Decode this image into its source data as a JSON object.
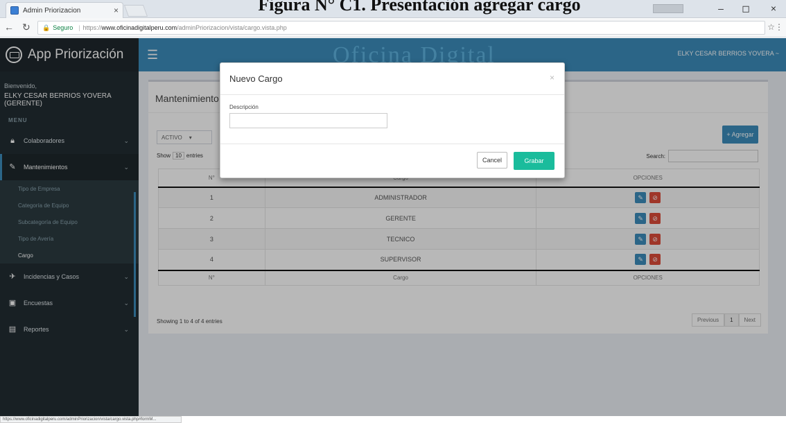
{
  "caption": "Figura N° C1. Presentación agregar cargo",
  "browser": {
    "tab_title": "Admin Priorizacion",
    "tab_close": "×",
    "windows_user": "",
    "minimize": "–",
    "maximize": "◻",
    "close": "×",
    "secure_label": "Seguro",
    "protocol": "https://",
    "host": "www.oficinadigitalperu.com",
    "path": "/adminPriorizacion/vista/cargo.vista.php",
    "status_url": "https://www.oficinadigitalperu.com/adminPriorizacion/vista/cargo.vista.php#formM..."
  },
  "sidebar": {
    "brand": "App Priorización",
    "welcome": "Bienvenido,",
    "user": "ELKY CESAR BERRIOS YOVERA (GERENTE)",
    "menu_header": "MENU",
    "items": [
      {
        "label": "Colaboradores",
        "icon": "lock-icon"
      },
      {
        "label": "Mantenimientos",
        "icon": "edit-icon"
      },
      {
        "label": "Incidencias y Casos",
        "icon": "ticket-icon"
      },
      {
        "label": "Encuestas",
        "icon": "clipboard-icon"
      },
      {
        "label": "Reportes",
        "icon": "report-icon"
      }
    ],
    "submenu": [
      "Tipo de Empresa",
      "Categoría de Equipo",
      "Subcategoría de Equipo",
      "Tipo de Avería",
      "Cargo"
    ]
  },
  "header": {
    "logo": "Oficina Digital",
    "user_menu": "ELKY CESAR BERRIOS YOVERA ~"
  },
  "main": {
    "title": "Mantenimiento",
    "filter_value": "ACTIVO",
    "add_button": "+ Agregar",
    "show_label": "Show",
    "show_value": "10",
    "entries_label": "entries",
    "search_label": "Search:",
    "columns": [
      "N°",
      "Cargo",
      "OPCIONES"
    ],
    "rows": [
      {
        "n": "1",
        "cargo": "ADMINISTRADOR"
      },
      {
        "n": "2",
        "cargo": "GERENTE"
      },
      {
        "n": "3",
        "cargo": "TECNICO"
      },
      {
        "n": "4",
        "cargo": "SUPERVISOR"
      }
    ],
    "info": "Showing 1 to 4 of 4 entries",
    "pager": [
      "Previous",
      "1",
      "Next"
    ]
  },
  "modal": {
    "title": "Nuevo Cargo",
    "close": "×",
    "field_label": "Descripción",
    "field_value": "",
    "cancel": "Cancel",
    "save": "Grabar"
  },
  "colors": {
    "primary": "#3c8dbc",
    "sidebar": "#222d32",
    "save": "#1abc9c",
    "danger": "#dd4b39"
  }
}
